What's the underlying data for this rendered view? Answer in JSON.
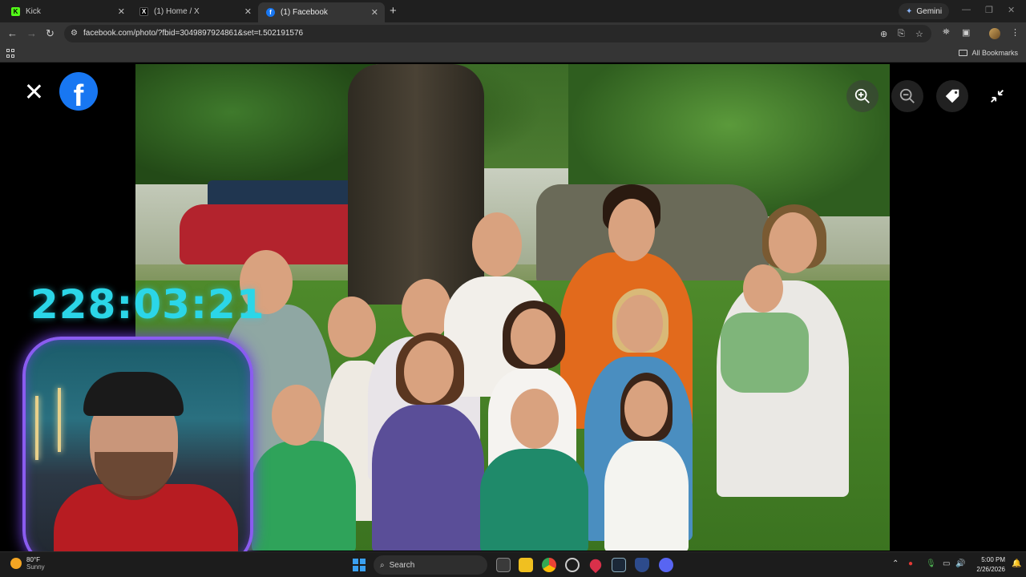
{
  "browser": {
    "tabs": [
      {
        "title": "Kick",
        "favicon": "kick-icon",
        "active": false
      },
      {
        "title": "(1) Home / X",
        "favicon": "x-icon",
        "active": false
      },
      {
        "title": "(1) Facebook",
        "favicon": "facebook-icon",
        "active": true
      }
    ],
    "gemini_label": "Gemini",
    "url": "facebook.com/photo/?fbid=3049897924861&set=t.502191576",
    "bookmarks": {
      "all_bookmarks_label": "All Bookmarks"
    }
  },
  "viewer": {
    "controls": [
      "close-icon",
      "zoom-in-icon",
      "zoom-out-icon",
      "tag-icon",
      "exit-fullscreen-icon"
    ],
    "brand_color": "#1877f2"
  },
  "overlay": {
    "timer": "228:03:21",
    "timer_color": "#2bd6e8",
    "webcam_border_color": "#8a5cf0"
  },
  "taskbar": {
    "weather_temp": "80°F",
    "weather_desc": "Sunny",
    "search_placeholder": "Search",
    "time": "5:00 PM",
    "date": "2/26/2026"
  }
}
